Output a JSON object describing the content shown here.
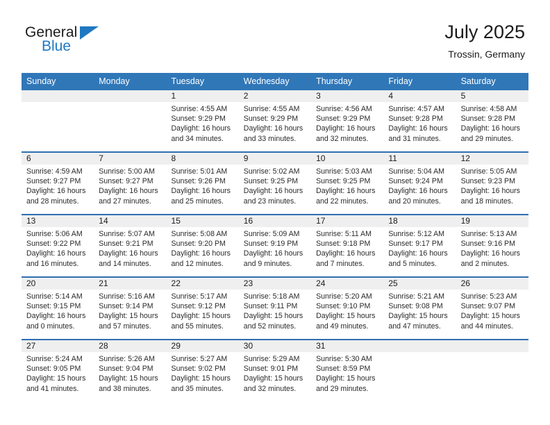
{
  "logo": {
    "word_one": "General",
    "word_two": "Blue",
    "accent_color": "#1f78c1"
  },
  "header": {
    "title": "July 2025",
    "subtitle": "Trossin, Germany"
  },
  "calendar": {
    "header_bg": "#3077b8",
    "daynum_bg": "#efefef",
    "weekdays": [
      "Sunday",
      "Monday",
      "Tuesday",
      "Wednesday",
      "Thursday",
      "Friday",
      "Saturday"
    ],
    "weeks": [
      [
        {
          "day": "",
          "sunrise": "",
          "sunset": "",
          "daylight": ""
        },
        {
          "day": "",
          "sunrise": "",
          "sunset": "",
          "daylight": ""
        },
        {
          "day": "1",
          "sunrise": "Sunrise: 4:55 AM",
          "sunset": "Sunset: 9:29 PM",
          "daylight": "Daylight: 16 hours and 34 minutes."
        },
        {
          "day": "2",
          "sunrise": "Sunrise: 4:55 AM",
          "sunset": "Sunset: 9:29 PM",
          "daylight": "Daylight: 16 hours and 33 minutes."
        },
        {
          "day": "3",
          "sunrise": "Sunrise: 4:56 AM",
          "sunset": "Sunset: 9:29 PM",
          "daylight": "Daylight: 16 hours and 32 minutes."
        },
        {
          "day": "4",
          "sunrise": "Sunrise: 4:57 AM",
          "sunset": "Sunset: 9:28 PM",
          "daylight": "Daylight: 16 hours and 31 minutes."
        },
        {
          "day": "5",
          "sunrise": "Sunrise: 4:58 AM",
          "sunset": "Sunset: 9:28 PM",
          "daylight": "Daylight: 16 hours and 29 minutes."
        }
      ],
      [
        {
          "day": "6",
          "sunrise": "Sunrise: 4:59 AM",
          "sunset": "Sunset: 9:27 PM",
          "daylight": "Daylight: 16 hours and 28 minutes."
        },
        {
          "day": "7",
          "sunrise": "Sunrise: 5:00 AM",
          "sunset": "Sunset: 9:27 PM",
          "daylight": "Daylight: 16 hours and 27 minutes."
        },
        {
          "day": "8",
          "sunrise": "Sunrise: 5:01 AM",
          "sunset": "Sunset: 9:26 PM",
          "daylight": "Daylight: 16 hours and 25 minutes."
        },
        {
          "day": "9",
          "sunrise": "Sunrise: 5:02 AM",
          "sunset": "Sunset: 9:25 PM",
          "daylight": "Daylight: 16 hours and 23 minutes."
        },
        {
          "day": "10",
          "sunrise": "Sunrise: 5:03 AM",
          "sunset": "Sunset: 9:25 PM",
          "daylight": "Daylight: 16 hours and 22 minutes."
        },
        {
          "day": "11",
          "sunrise": "Sunrise: 5:04 AM",
          "sunset": "Sunset: 9:24 PM",
          "daylight": "Daylight: 16 hours and 20 minutes."
        },
        {
          "day": "12",
          "sunrise": "Sunrise: 5:05 AM",
          "sunset": "Sunset: 9:23 PM",
          "daylight": "Daylight: 16 hours and 18 minutes."
        }
      ],
      [
        {
          "day": "13",
          "sunrise": "Sunrise: 5:06 AM",
          "sunset": "Sunset: 9:22 PM",
          "daylight": "Daylight: 16 hours and 16 minutes."
        },
        {
          "day": "14",
          "sunrise": "Sunrise: 5:07 AM",
          "sunset": "Sunset: 9:21 PM",
          "daylight": "Daylight: 16 hours and 14 minutes."
        },
        {
          "day": "15",
          "sunrise": "Sunrise: 5:08 AM",
          "sunset": "Sunset: 9:20 PM",
          "daylight": "Daylight: 16 hours and 12 minutes."
        },
        {
          "day": "16",
          "sunrise": "Sunrise: 5:09 AM",
          "sunset": "Sunset: 9:19 PM",
          "daylight": "Daylight: 16 hours and 9 minutes."
        },
        {
          "day": "17",
          "sunrise": "Sunrise: 5:11 AM",
          "sunset": "Sunset: 9:18 PM",
          "daylight": "Daylight: 16 hours and 7 minutes."
        },
        {
          "day": "18",
          "sunrise": "Sunrise: 5:12 AM",
          "sunset": "Sunset: 9:17 PM",
          "daylight": "Daylight: 16 hours and 5 minutes."
        },
        {
          "day": "19",
          "sunrise": "Sunrise: 5:13 AM",
          "sunset": "Sunset: 9:16 PM",
          "daylight": "Daylight: 16 hours and 2 minutes."
        }
      ],
      [
        {
          "day": "20",
          "sunrise": "Sunrise: 5:14 AM",
          "sunset": "Sunset: 9:15 PM",
          "daylight": "Daylight: 16 hours and 0 minutes."
        },
        {
          "day": "21",
          "sunrise": "Sunrise: 5:16 AM",
          "sunset": "Sunset: 9:14 PM",
          "daylight": "Daylight: 15 hours and 57 minutes."
        },
        {
          "day": "22",
          "sunrise": "Sunrise: 5:17 AM",
          "sunset": "Sunset: 9:12 PM",
          "daylight": "Daylight: 15 hours and 55 minutes."
        },
        {
          "day": "23",
          "sunrise": "Sunrise: 5:18 AM",
          "sunset": "Sunset: 9:11 PM",
          "daylight": "Daylight: 15 hours and 52 minutes."
        },
        {
          "day": "24",
          "sunrise": "Sunrise: 5:20 AM",
          "sunset": "Sunset: 9:10 PM",
          "daylight": "Daylight: 15 hours and 49 minutes."
        },
        {
          "day": "25",
          "sunrise": "Sunrise: 5:21 AM",
          "sunset": "Sunset: 9:08 PM",
          "daylight": "Daylight: 15 hours and 47 minutes."
        },
        {
          "day": "26",
          "sunrise": "Sunrise: 5:23 AM",
          "sunset": "Sunset: 9:07 PM",
          "daylight": "Daylight: 15 hours and 44 minutes."
        }
      ],
      [
        {
          "day": "27",
          "sunrise": "Sunrise: 5:24 AM",
          "sunset": "Sunset: 9:05 PM",
          "daylight": "Daylight: 15 hours and 41 minutes."
        },
        {
          "day": "28",
          "sunrise": "Sunrise: 5:26 AM",
          "sunset": "Sunset: 9:04 PM",
          "daylight": "Daylight: 15 hours and 38 minutes."
        },
        {
          "day": "29",
          "sunrise": "Sunrise: 5:27 AM",
          "sunset": "Sunset: 9:02 PM",
          "daylight": "Daylight: 15 hours and 35 minutes."
        },
        {
          "day": "30",
          "sunrise": "Sunrise: 5:29 AM",
          "sunset": "Sunset: 9:01 PM",
          "daylight": "Daylight: 15 hours and 32 minutes."
        },
        {
          "day": "31",
          "sunrise": "Sunrise: 5:30 AM",
          "sunset": "Sunset: 8:59 PM",
          "daylight": "Daylight: 15 hours and 29 minutes."
        },
        {
          "day": "",
          "sunrise": "",
          "sunset": "",
          "daylight": ""
        },
        {
          "day": "",
          "sunrise": "",
          "sunset": "",
          "daylight": ""
        }
      ]
    ]
  }
}
